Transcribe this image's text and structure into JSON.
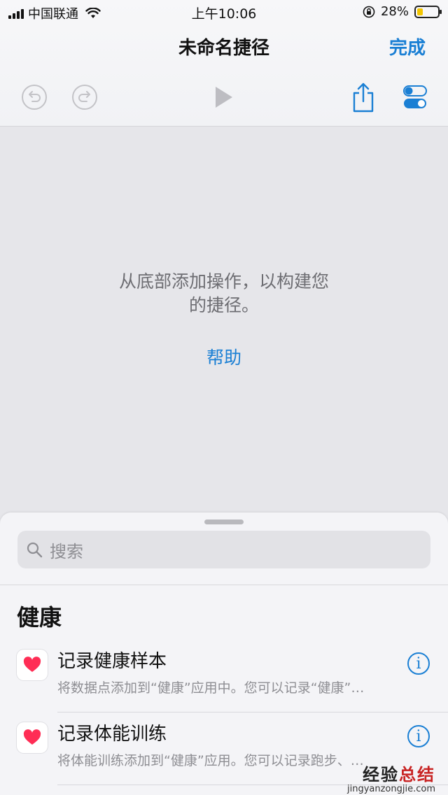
{
  "status_bar": {
    "carrier": "中国联通",
    "time": "上午10:06",
    "battery_percent": "28%",
    "battery_level": 0.28,
    "battery_color": "#f2c500"
  },
  "nav": {
    "title": "未命名捷径",
    "done_label": "完成"
  },
  "toolbar": {
    "undo_icon": "undo-icon",
    "redo_icon": "redo-icon",
    "play_icon": "play-icon",
    "share_icon": "share-icon",
    "settings_icon": "toggle-settings-icon"
  },
  "editor": {
    "empty_line1": "从底部添加操作，以构建您",
    "empty_line2": "的捷径。",
    "help_label": "帮助"
  },
  "sheet": {
    "search_placeholder": "搜索",
    "section_title": "健康",
    "actions": [
      {
        "title": "记录健康样本",
        "subtitle": "将数据点添加到“健康”应用中。您可以记录“健康”…",
        "icon": "heart-icon"
      },
      {
        "title": "记录体能训练",
        "subtitle": "将体能训练添加到“健康”应用。您可以记录跑步、…",
        "icon": "heart-icon"
      }
    ]
  },
  "watermark": {
    "text_a": "经验",
    "text_b": "总结",
    "url": "jingyanzongjie.com"
  },
  "colors": {
    "accent": "#1a7fd4",
    "heart": "#ff2d55"
  }
}
